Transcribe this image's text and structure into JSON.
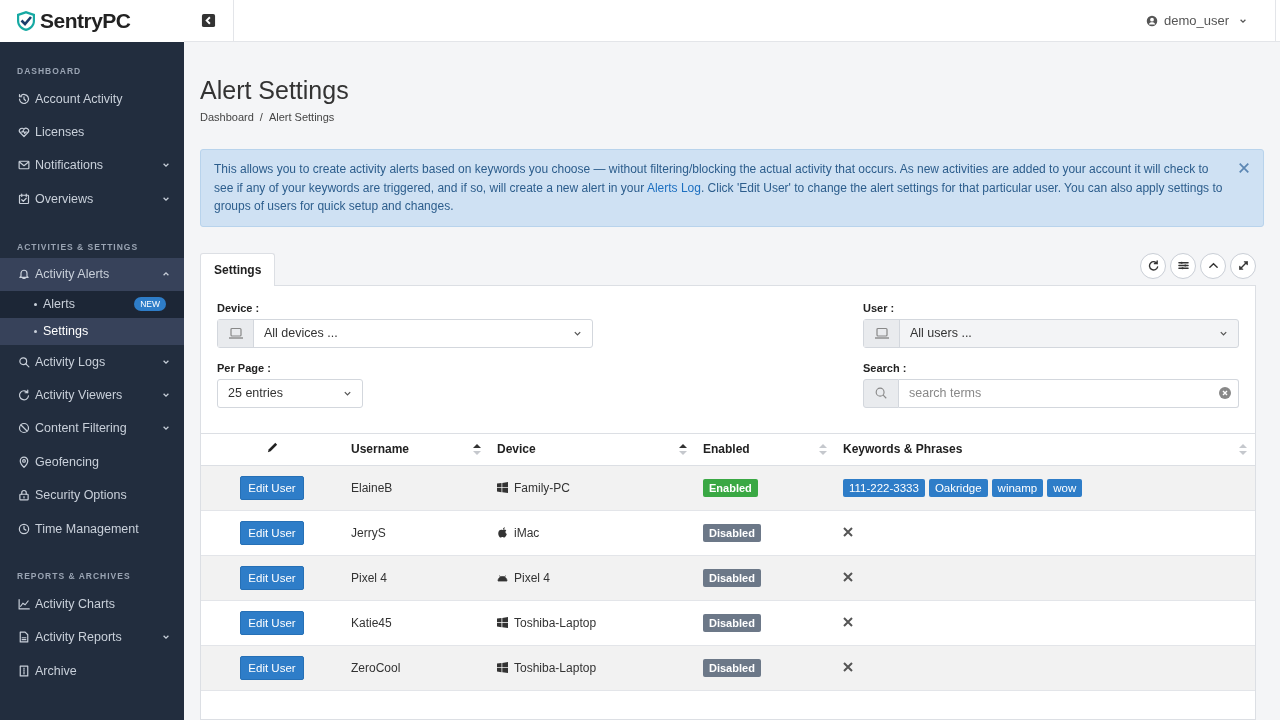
{
  "brand": {
    "name": "SentryPC"
  },
  "user_menu": {
    "label": "demo_user"
  },
  "sidebar": {
    "sections": [
      {
        "title": "DASHBOARD",
        "items": [
          {
            "label": "Account Activity",
            "expandable": false,
            "expanded": false,
            "selected": false
          },
          {
            "label": "Licenses",
            "expandable": false,
            "expanded": false,
            "selected": false
          },
          {
            "label": "Notifications",
            "expandable": true,
            "expanded": false,
            "selected": false
          },
          {
            "label": "Overviews",
            "expandable": true,
            "expanded": false,
            "selected": false
          }
        ]
      },
      {
        "title": "ACTIVITIES & SETTINGS",
        "items": [
          {
            "label": "Activity Alerts",
            "expandable": true,
            "expanded": true,
            "selected": false,
            "children": [
              {
                "label": "Alerts",
                "badge": "NEW",
                "selected": false
              },
              {
                "label": "Settings",
                "selected": true
              }
            ]
          },
          {
            "label": "Activity Logs",
            "expandable": true,
            "expanded": false,
            "selected": false
          },
          {
            "label": "Activity Viewers",
            "expandable": true,
            "expanded": false,
            "selected": false
          },
          {
            "label": "Content Filtering",
            "expandable": true,
            "expanded": false,
            "selected": false
          },
          {
            "label": "Geofencing",
            "expandable": false,
            "expanded": false,
            "selected": false
          },
          {
            "label": "Security Options",
            "expandable": false,
            "expanded": false,
            "selected": false
          },
          {
            "label": "Time Management",
            "expandable": false,
            "expanded": false,
            "selected": false
          }
        ]
      },
      {
        "title": "REPORTS & ARCHIVES",
        "items": [
          {
            "label": "Activity Charts",
            "expandable": false,
            "expanded": false,
            "selected": false
          },
          {
            "label": "Activity Reports",
            "expandable": true,
            "expanded": false,
            "selected": false
          },
          {
            "label": "Archive",
            "expandable": false,
            "expanded": false,
            "selected": false
          }
        ]
      }
    ]
  },
  "page": {
    "title": "Alert Settings",
    "breadcrumb": [
      "Dashboard",
      "Alert Settings"
    ],
    "breadcrumb_separator": "/"
  },
  "info_alert": {
    "text_before": "This allows you to create activity alerts based on keywords you choose — without filtering/blocking the actual activity that occurs.  As new activities are added to your account it will check to see if any of your keywords are triggered, and if so, will create a new alert in your ",
    "link": "Alerts Log",
    "text_after": ".  Click 'Edit User' to change the alert settings for that particular user.  You can also apply settings to groups of users for quick setup and changes."
  },
  "tabs": [
    {
      "label": "Settings",
      "selected": true
    }
  ],
  "filters": {
    "device": {
      "label": "Device :",
      "value": "All devices ..."
    },
    "user": {
      "label": "User :",
      "value": "All users ..."
    },
    "per_page": {
      "label": "Per Page :",
      "value": "25 entries"
    },
    "search": {
      "label": "Search :",
      "placeholder": "search terms"
    }
  },
  "table": {
    "columns": [
      {
        "kind": "edit"
      },
      {
        "label": "Username",
        "kind": "sorted"
      },
      {
        "label": "Device",
        "kind": "sorted"
      },
      {
        "label": "Enabled",
        "kind": "sortable"
      },
      {
        "label": "Keywords & Phrases",
        "kind": "sortable"
      }
    ],
    "rows": [
      {
        "action": "Edit User",
        "username": "ElaineB",
        "device": "Family-PC",
        "kind": "windows",
        "status": "Enabled",
        "enabled": true,
        "keywords": [
          "111-222-3333",
          "Oakridge",
          "winamp",
          "wow"
        ]
      },
      {
        "action": "Edit User",
        "username": "JerryS",
        "device": "iMac",
        "kind": "apple",
        "status": "Disabled",
        "enabled": false
      },
      {
        "action": "Edit User",
        "username": "Pixel 4",
        "device": "Pixel 4",
        "kind": "android",
        "status": "Disabled",
        "enabled": false
      },
      {
        "action": "Edit User",
        "username": "Katie45",
        "device": "Toshiba-Laptop",
        "kind": "windows",
        "status": "Disabled",
        "enabled": false
      },
      {
        "action": "Edit User",
        "username": "ZeroCool",
        "device": "Toshiba-Laptop",
        "kind": "windows",
        "status": "Disabled",
        "enabled": false
      }
    ]
  }
}
